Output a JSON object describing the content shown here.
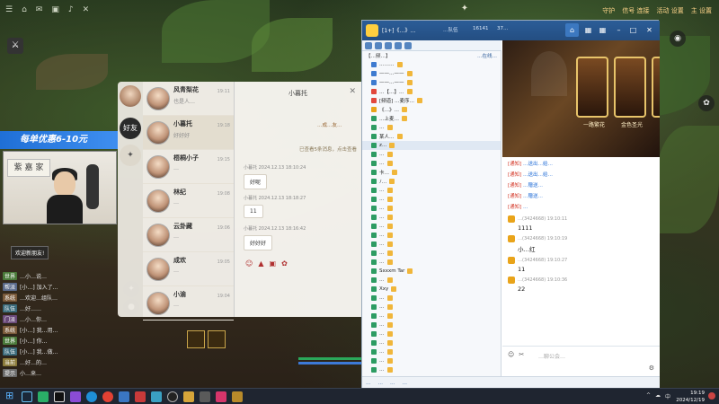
{
  "hud": {
    "top_right": [
      "守护",
      "信号 连接",
      "活动 设置",
      "主 设置"
    ],
    "emblem": "✦"
  },
  "stream": {
    "promo": "每单优惠6-10元",
    "poster": "紫 嘉 家",
    "tag": "欢迎新朋友!"
  },
  "chatlog": [
    {
      "ch": "世界",
      "color": "#4a7a3a",
      "msg": "…小…说…"
    },
    {
      "ch": "帮派",
      "color": "#5a6a8a",
      "msg": "[小…] 加入了…"
    },
    {
      "ch": "系统",
      "color": "#7a5a3a",
      "msg": "…欢迎…组队…"
    },
    {
      "ch": "队伍",
      "color": "#3a6a7a",
      "msg": "…好……"
    },
    {
      "ch": "门派",
      "color": "#6a4a7a",
      "msg": "…小…你…"
    },
    {
      "ch": "系统",
      "color": "#7a5a3a",
      "msg": "[小…] 我…用…"
    },
    {
      "ch": "世界",
      "color": "#4a7a3a",
      "msg": "[小…] 你…"
    },
    {
      "ch": "队伍",
      "color": "#3a6a7a",
      "msg": "[小…] 我…做…"
    },
    {
      "ch": "当前",
      "color": "#8a7a3a",
      "msg": "…好…的…"
    },
    {
      "ch": "提示",
      "color": "#6a6a6a",
      "msg": "小…来…"
    }
  ],
  "social": {
    "tab_active": "好友",
    "tab_plain": "✦",
    "contacts": [
      {
        "name": "风青梨花",
        "sub": "也是人…",
        "time": "19:11"
      },
      {
        "name": "小暮托",
        "sub": "好好好",
        "time": "19:18",
        "selected": true
      },
      {
        "name": "梧桐小子",
        "sub": "…",
        "time": "19:15"
      },
      {
        "name": "林纪",
        "sub": "…",
        "time": "19:08"
      },
      {
        "name": "云卦藏",
        "sub": "…",
        "time": "19:06"
      },
      {
        "name": "成欢",
        "sub": "…",
        "time": "19:05"
      },
      {
        "name": "小渝",
        "sub": "…",
        "time": "19:04"
      }
    ],
    "chat": {
      "title": "小暮托",
      "close": "✕",
      "system": "…成…友…",
      "note": "已查看5条消息，点击查看",
      "messages": [
        {
          "meta": "小暮托  2024.12.13 18:10:24",
          "text": "好呢"
        },
        {
          "meta": "小暮托  2024.12.13 18:18:27",
          "text": "11"
        },
        {
          "meta": "小暮托  2024.12.13 18:16:42",
          "text": "好好好"
        }
      ],
      "tools": [
        "☺",
        "▲",
        "▣",
        "✿"
      ]
    }
  },
  "qt": {
    "title": "[1+]《…》…",
    "id_label": "…队伍",
    "items": [
      "16141",
      "37…"
    ],
    "home_icon": "⌂",
    "left_header": {
      "left": "【…频…】",
      "right": "…在线…"
    },
    "rows": [
      {
        "text": "………",
        "ic": "b"
      },
      {
        "text": "——…——",
        "ic": "b"
      },
      {
        "text": "——…——",
        "ic": "b"
      },
      {
        "text": "…【…】…",
        "ic": "r"
      },
      {
        "text": "[频道] …麦序…",
        "ic": "r"
      },
      {
        "text": "《…》…",
        "ic": "y"
      },
      {
        "text": "…上麦…",
        "ic": "g"
      },
      {
        "text": "…",
        "ic": "g"
      },
      {
        "text": "某人…",
        "ic": "g"
      },
      {
        "text": "z…",
        "ic": "g",
        "hl": true
      },
      {
        "text": "…",
        "ic": "g"
      },
      {
        "text": "…",
        "ic": "g"
      },
      {
        "text": "卡…",
        "ic": "g"
      },
      {
        "text": "ﾉ…",
        "ic": "g"
      },
      {
        "text": "…",
        "ic": "g"
      },
      {
        "text": "…",
        "ic": "g"
      },
      {
        "text": "…",
        "ic": "g"
      },
      {
        "text": "…",
        "ic": "g"
      },
      {
        "text": "…",
        "ic": "g"
      },
      {
        "text": "…",
        "ic": "g"
      },
      {
        "text": "…",
        "ic": "g"
      },
      {
        "text": "…",
        "ic": "g"
      },
      {
        "text": "…",
        "ic": "g"
      },
      {
        "text": "Sxxxm Tar",
        "ic": "g"
      },
      {
        "text": "…",
        "ic": "g"
      },
      {
        "text": "Xxy",
        "ic": "g"
      },
      {
        "text": "…",
        "ic": "g"
      },
      {
        "text": "…",
        "ic": "g"
      },
      {
        "text": "…",
        "ic": "g"
      },
      {
        "text": "…",
        "ic": "g"
      },
      {
        "text": "…",
        "ic": "g"
      },
      {
        "text": "…",
        "ic": "g"
      },
      {
        "text": "…",
        "ic": "g"
      },
      {
        "text": "…",
        "ic": "g"
      },
      {
        "text": "…",
        "ic": "g"
      },
      {
        "text": "…",
        "ic": "g"
      }
    ],
    "banner_cards": [
      "一路繁花",
      "金色圣光",
      "…"
    ],
    "system_msgs": [
      {
        "k": "[通知]",
        "t": "…送出…给…"
      },
      {
        "k": "[通知]",
        "t": "…送出…给…"
      },
      {
        "k": "[通知]",
        "t": "…赠送…"
      },
      {
        "k": "[通知]",
        "t": "…赠送…"
      },
      {
        "k": "[通知]",
        "t": "…"
      }
    ],
    "msgs": [
      {
        "meta": "…(3424668)  19:10:11",
        "text": "1111"
      },
      {
        "meta": "…(3424668)  19:10:19",
        "text": "小…红"
      },
      {
        "meta": "…(3424668)  19:10:27",
        "text": "11"
      },
      {
        "meta": "…(3424668)  19:10:36",
        "text": "22"
      }
    ],
    "input_placeholder": "…聊公会…",
    "input_tools": [
      "☺",
      "✂"
    ],
    "send": "⚙",
    "footer": [
      "…",
      "…",
      "…",
      "…"
    ]
  },
  "taskbar": {
    "start": "⊞",
    "tray": [
      "^",
      "☁",
      "中"
    ],
    "time": "19:19",
    "date": "2024/12/19"
  }
}
